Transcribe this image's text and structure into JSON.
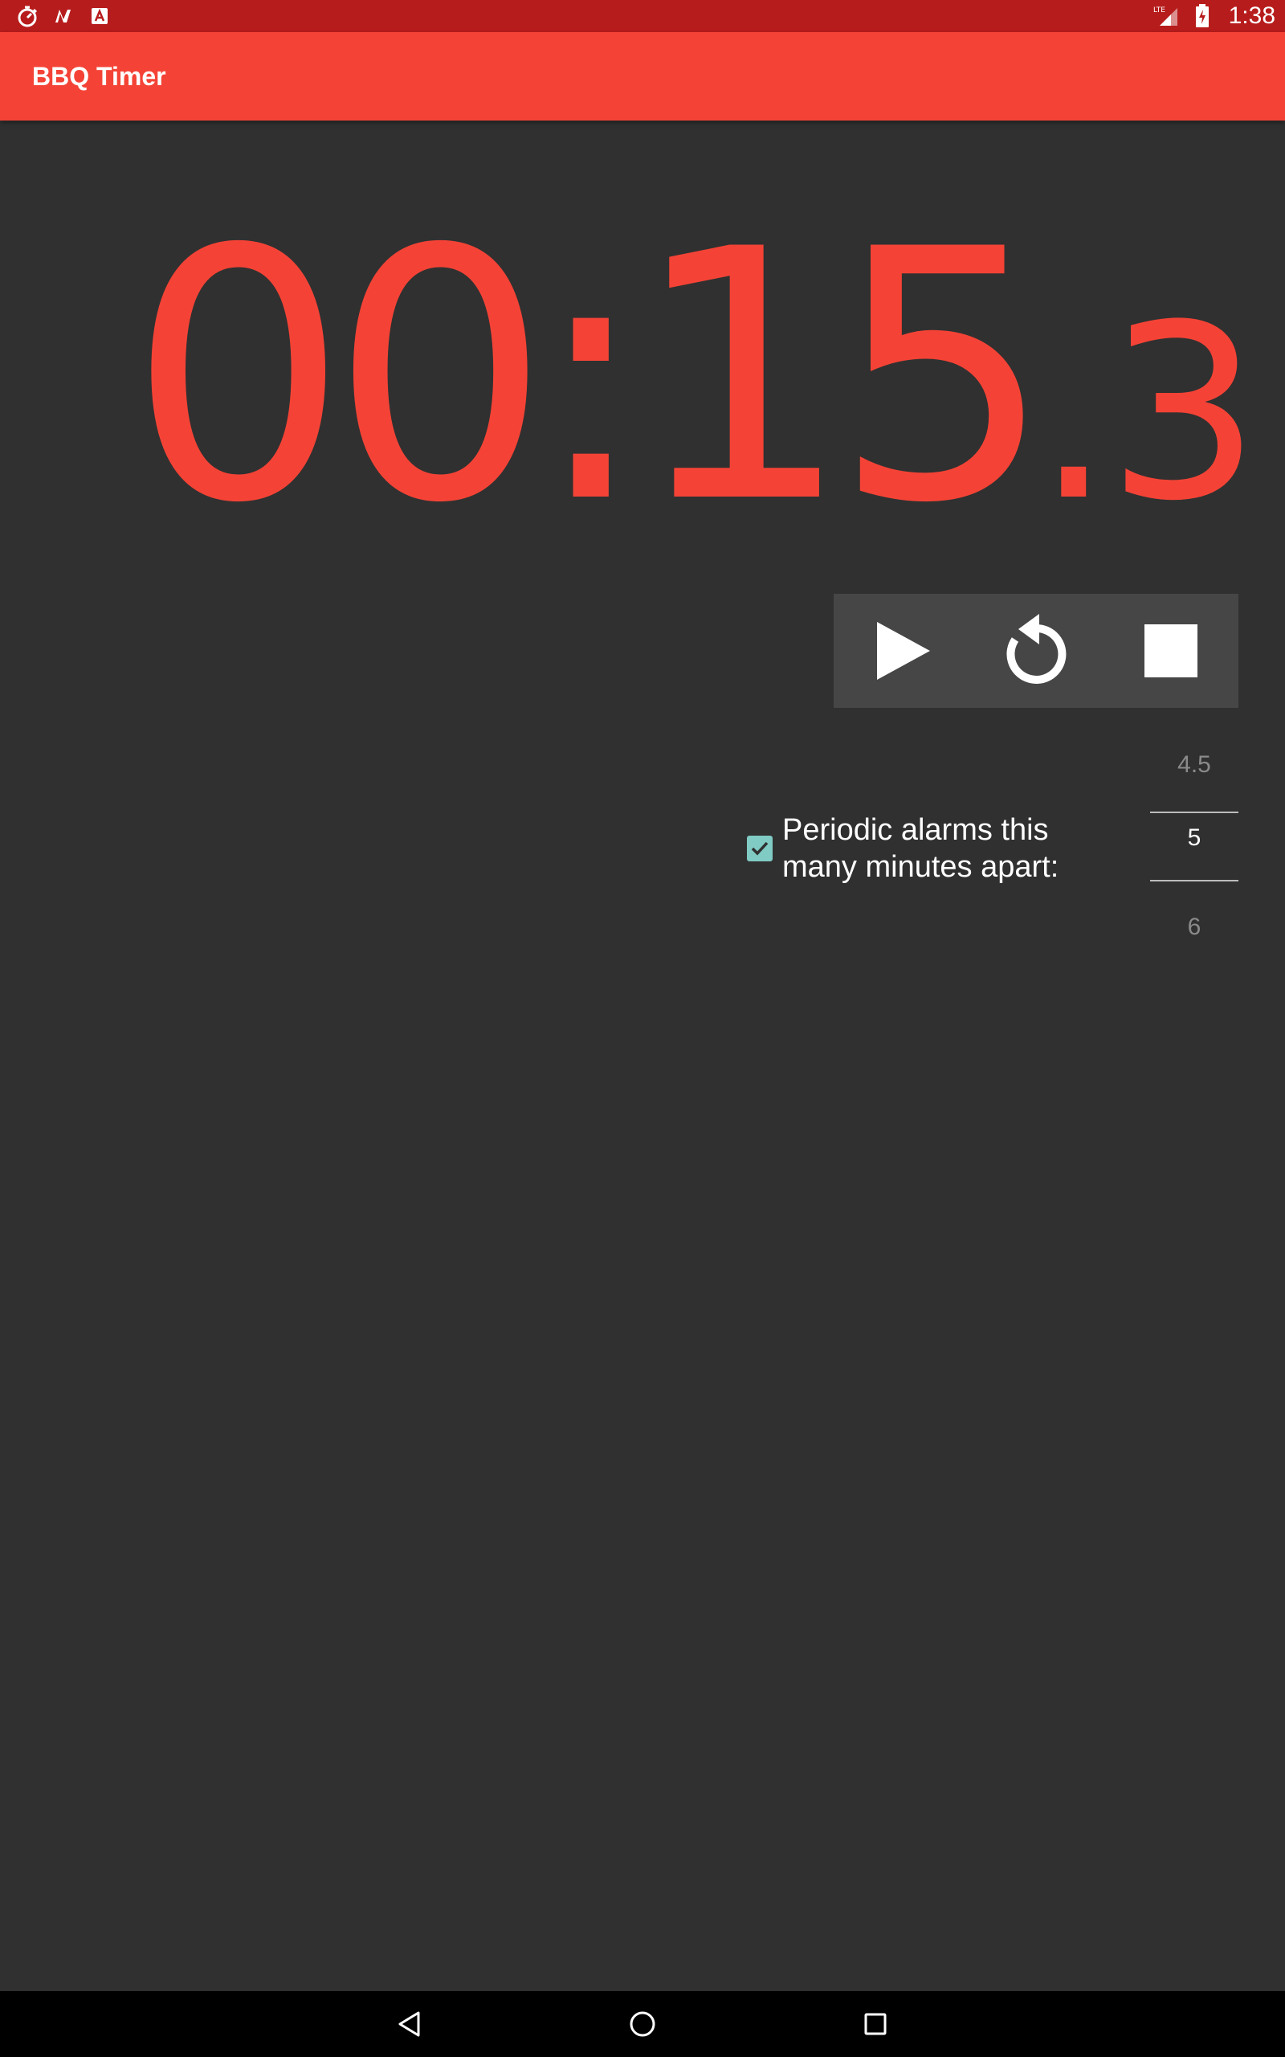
{
  "status_bar": {
    "time": "1:38",
    "icons": [
      "stopwatch-icon",
      "n-notification-icon",
      "a-notification-icon",
      "lte-signal-icon",
      "battery-charging-icon"
    ]
  },
  "app_bar": {
    "title": "BBQ Timer",
    "color": "#f44336"
  },
  "timer": {
    "main": "00:15",
    "fraction": ".3",
    "color": "#f44336"
  },
  "controls": {
    "buttons": [
      "play-icon",
      "reset-icon",
      "stop-icon"
    ]
  },
  "alarms": {
    "checked": true,
    "label_line1": "Periodic alarms this",
    "label_line2": "many minutes apart:",
    "picker": {
      "previous": "4.5",
      "current": "5",
      "next": "6"
    }
  },
  "nav_bar": {
    "buttons": [
      "back-icon",
      "home-icon",
      "recents-icon"
    ]
  }
}
